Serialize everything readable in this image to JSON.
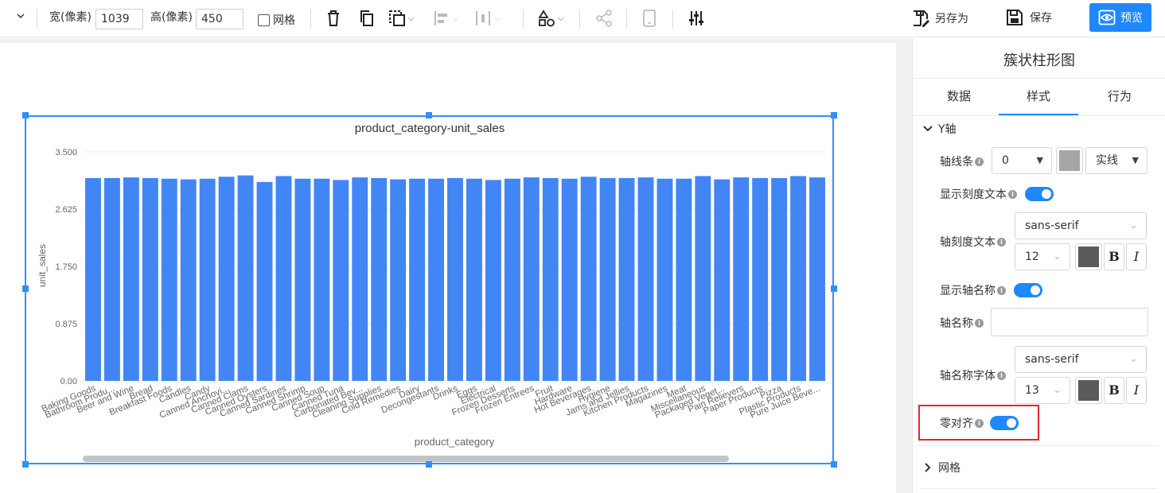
{
  "toolbar": {
    "width_label": "宽(像素)",
    "width_value": "1039",
    "height_label": "高(像素)",
    "height_value": "450",
    "grid_label": "网格",
    "save_as_label": "另存为",
    "save_label": "保存",
    "preview_label": "预览"
  },
  "panel": {
    "title": "簇状柱形图",
    "tabs": [
      "数据",
      "样式",
      "行为"
    ],
    "active_tab": "样式",
    "section_y_axis": "Y轴",
    "axis_line_label": "轴线条",
    "axis_line_width": "0",
    "axis_line_color": "#a6a6a6",
    "axis_line_style": "实线",
    "show_tick_text_label": "显示刻度文本",
    "tick_text_label": "轴刻度文本",
    "tick_font": "sans-serif",
    "tick_size": "12",
    "tick_color": "#5a5a5a",
    "bold_label": "B",
    "italic_label": "I",
    "show_axis_name_label": "显示轴名称",
    "axis_name_label": "轴名称",
    "axis_name_value": "",
    "axis_name_font_label": "轴名称字体",
    "axis_name_font": "sans-serif",
    "axis_name_size": "13",
    "axis_name_color": "#5a5a5a",
    "zero_align_label": "零对齐",
    "section_grid": "网格"
  },
  "chart_data": {
    "type": "bar",
    "title": "product_category-unit_sales",
    "xlabel": "product_category",
    "ylabel": "unit_sales",
    "ylim": [
      0,
      3.5
    ],
    "yticks": [
      "0.00",
      "0.875",
      "1.750",
      "2.625",
      "3.500"
    ],
    "bar_color": "#4285f4",
    "grid": true,
    "categories": [
      "Baking Goods",
      "Bathroom Produ...",
      "Beer and Wine",
      "Bread",
      "Breakfast Foods",
      "Candles",
      "Candy",
      "Canned Anchovi...",
      "Canned Clams",
      "Canned Oysters",
      "Canned Sardines",
      "Canned Shrimp",
      "Canned Soup",
      "Canned Tuna",
      "Carbonated Bev...",
      "Cleaning Supplies",
      "Cold Remedies",
      "Dairy",
      "Decongestants",
      "Drinks",
      "Eggs",
      "Electrical",
      "Frozen Desserts",
      "Frozen Entrees",
      "Fruit",
      "Hardware",
      "Hot Beverages",
      "Hygiene",
      "Jams and Jellies",
      "Kitchen Products",
      "Magazines",
      "Meat",
      "Miscellaneous",
      "Packaged Veget...",
      "Pain Relievers",
      "Paper Products",
      "Pizza",
      "Plastic Products",
      "Pure Juice Beve..."
    ],
    "values": [
      3.1,
      3.1,
      3.11,
      3.1,
      3.09,
      3.08,
      3.09,
      3.12,
      3.14,
      3.04,
      3.13,
      3.09,
      3.09,
      3.07,
      3.11,
      3.1,
      3.08,
      3.09,
      3.09,
      3.1,
      3.09,
      3.07,
      3.09,
      3.11,
      3.1,
      3.09,
      3.12,
      3.1,
      3.1,
      3.11,
      3.09,
      3.09,
      3.13,
      3.08,
      3.11,
      3.1,
      3.1,
      3.13,
      3.11
    ]
  }
}
